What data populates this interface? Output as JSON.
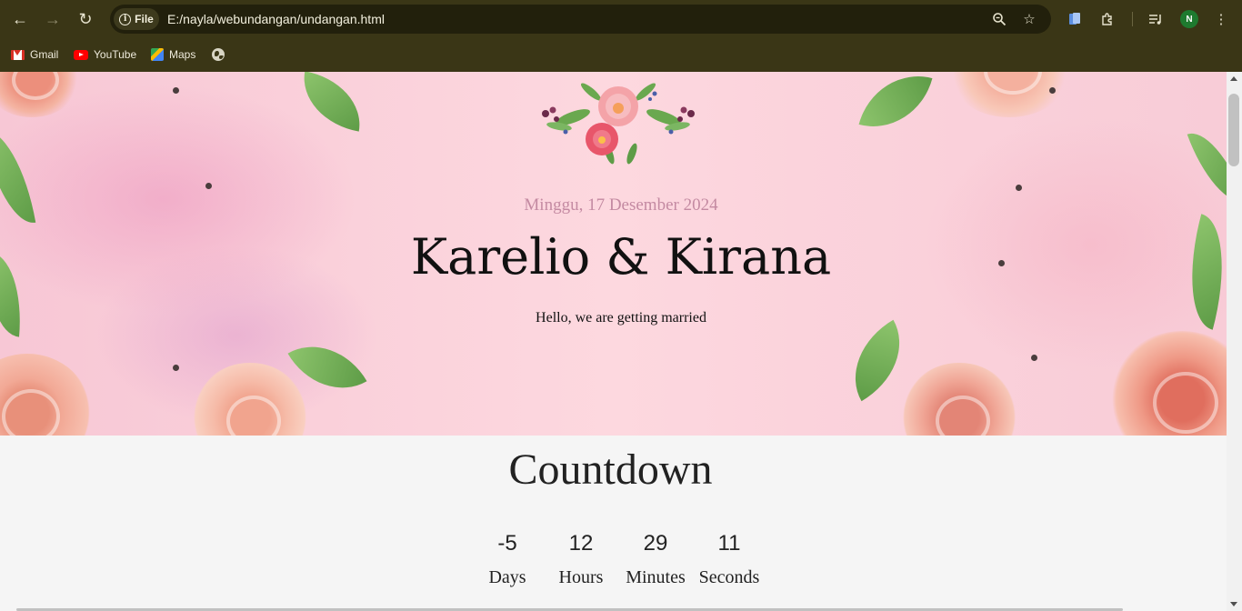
{
  "browser": {
    "site_chip_label": "File",
    "url": "E:/nayla/webundangan/undangan.html",
    "profile_initial": "N",
    "bookmarks": [
      {
        "label": "Gmail",
        "icon": "gmail-icon"
      },
      {
        "label": "YouTube",
        "icon": "youtube-icon"
      },
      {
        "label": "Maps",
        "icon": "maps-icon"
      }
    ],
    "nav_icons": [
      "back-arrow-icon",
      "forward-arrow-icon",
      "reload-icon"
    ],
    "toolbar_icons": [
      "zoom-icon",
      "bookmark-star-icon",
      "extension-app-icon",
      "extensions-puzzle-icon",
      "media-queue-icon",
      "menu-kebab-icon"
    ]
  },
  "hero": {
    "date": "Minggu, 17 Desember 2024",
    "names": "Karelio & Kirana",
    "tagline": "Hello, we are getting married"
  },
  "countdown": {
    "title": "Countdown",
    "items": [
      {
        "value": "-5",
        "label": "Days"
      },
      {
        "value": "12",
        "label": "Hours"
      },
      {
        "value": "29",
        "label": "Minutes"
      },
      {
        "value": "11",
        "label": "Seconds"
      }
    ]
  },
  "colors": {
    "chrome_bg": "#3a3616",
    "omnibox_bg": "#22200c",
    "hero_pink": "#fdd8df",
    "date_color": "#c48aa2",
    "page_bg": "#f5f5f5"
  }
}
